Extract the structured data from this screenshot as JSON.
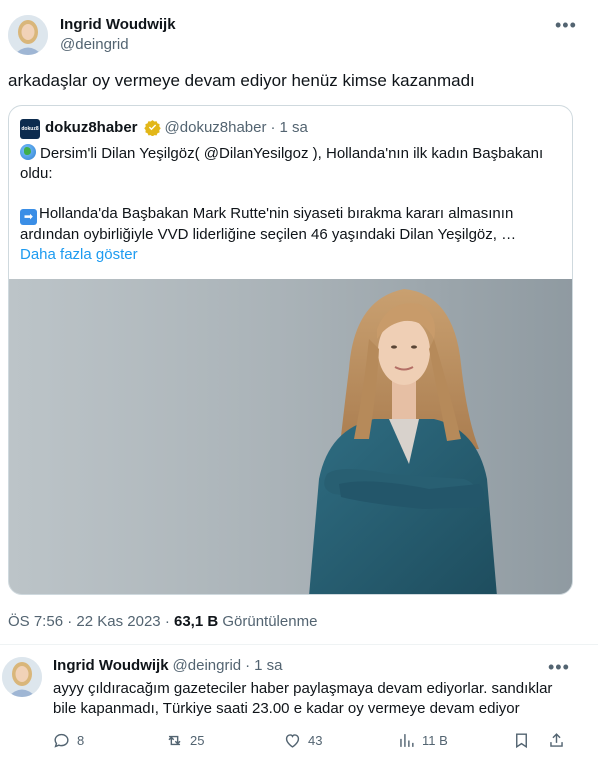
{
  "author": {
    "name": "Ingrid Woudwijk",
    "handle": "@deingrid"
  },
  "tweet": {
    "text": "arkadaşlar oy vermeye devam ediyor henüz kimse kazanmadı"
  },
  "quote": {
    "logo_text": "dokuz8",
    "name": "dokuz8haber",
    "handle": "@dokuz8haber",
    "separator": "·",
    "time": "1 sa",
    "line1_a": "Dersim'li Dilan Yeşilgöz( ",
    "line1_mention": "@DilanYesilgoz",
    "line1_b": " ), Hollanda'nın ilk kadın Başbakanı",
    "line2": "oldu:",
    "line3": "Hollanda'da Başbakan Mark Rutte'nin siyaseti bırakma kararı almasının",
    "line4": "ardından oybirliğiyle VVD liderliğine seçilen 46 yaşındaki Dilan Yeşilgöz, …",
    "show_more": "Daha fazla göster",
    "icon_globe": "earth-globe-icon",
    "icon_arrow": "right-arrow-emoji-icon"
  },
  "meta": {
    "time": "ÖS 7:56",
    "sep1": "·",
    "date": "22 Kas 2023",
    "sep2": "·",
    "views_count": "63,1 B",
    "views_label": "Görüntülenme"
  },
  "reply": {
    "name": "Ingrid Woudwijk",
    "handle": "@deingrid",
    "separator": "·",
    "time": "1 sa",
    "line1": "ayyy çıldıracağım gazeteciler haber paylaşmaya devam ediyorlar. sandıklar",
    "line2": "bile kapanmadı, Türkiye saati 23.00 e kadar oy vermeye devam ediyor",
    "actions": {
      "replies": "8",
      "retweets": "25",
      "likes": "43",
      "views": "11 B"
    }
  },
  "colors": {
    "accent": "#1d9bf0",
    "text": "#0f1419",
    "muted": "#536471",
    "border": "#cfd9de",
    "verified_gold": "#e2b719"
  }
}
